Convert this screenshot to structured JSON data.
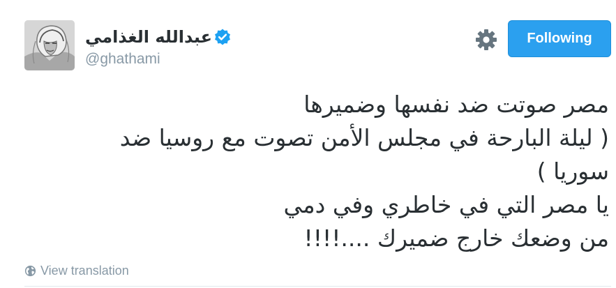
{
  "account": {
    "display_name": "عبدالله الغذامي",
    "handle": "@ghathami",
    "verified": true
  },
  "actions": {
    "settings_icon": "gear-icon",
    "follow_label": "Following"
  },
  "tweet": {
    "lines": [
      "مصر صوتت ضد نفسها وضميرها",
      "( ليلة البارحة في مجلس الأمن تصوت مع روسيا ضد",
      "سوريا )",
      "يا مصر التي في خاطري وفي دمي",
      "من وضعك خارج ضميرك ....!!!!"
    ]
  },
  "translation": {
    "icon": "globe-icon",
    "label": "View translation"
  },
  "colors": {
    "accent": "#2ba0ef",
    "verified": "#1da1f2",
    "text": "#292f33",
    "muted": "#8899a6",
    "divider": "#e1e8ed"
  }
}
